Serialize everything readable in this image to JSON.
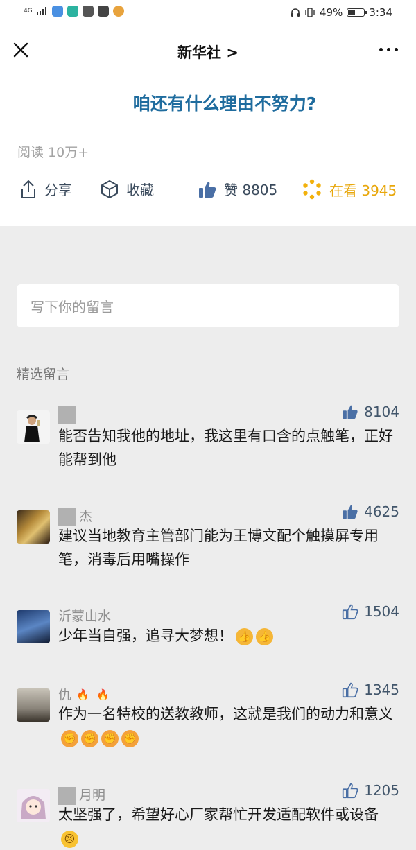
{
  "status_bar": {
    "network": "4G",
    "battery_text": "49%",
    "battery_level": 0.49,
    "time": "3:34"
  },
  "nav": {
    "title": "新华社 >",
    "close_icon": "close-icon",
    "more_icon": "more-icon"
  },
  "article": {
    "headline": "咱还有什么理由不努力?",
    "reads": "阅读 10万+"
  },
  "actions": {
    "share": "分享",
    "collect": "收藏",
    "like": "赞 8805",
    "watch": "在看 3945"
  },
  "comment_input": {
    "placeholder": "写下你的留言"
  },
  "featured_label": "精选留言",
  "comments": [
    {
      "name": "",
      "likes": "8104",
      "text": "能否告知我他的地址，我这里有口含的点触笔，正好能帮到他",
      "liked": true
    },
    {
      "name": "杰",
      "likes": "4625",
      "text": "建议当地教育主管部门能为王博文配个触摸屏专用笔，消毒后用嘴操作",
      "liked": true
    },
    {
      "name": "沂蒙山水",
      "likes": "1504",
      "text": "少年当自强，追寻大梦想！",
      "liked": false
    },
    {
      "name": "仇",
      "likes": "1345",
      "text": "作为一名特校的送教教师，这就是我们的动力和意义",
      "liked": false
    },
    {
      "name": "月明",
      "likes": "1205",
      "text": "太坚强了，希望好心厂家帮忙开发适配软件或设备",
      "liked": false
    }
  ],
  "colors": {
    "headline": "#1f6c9e",
    "watch": "#e8a70b",
    "background": "#ededed"
  }
}
